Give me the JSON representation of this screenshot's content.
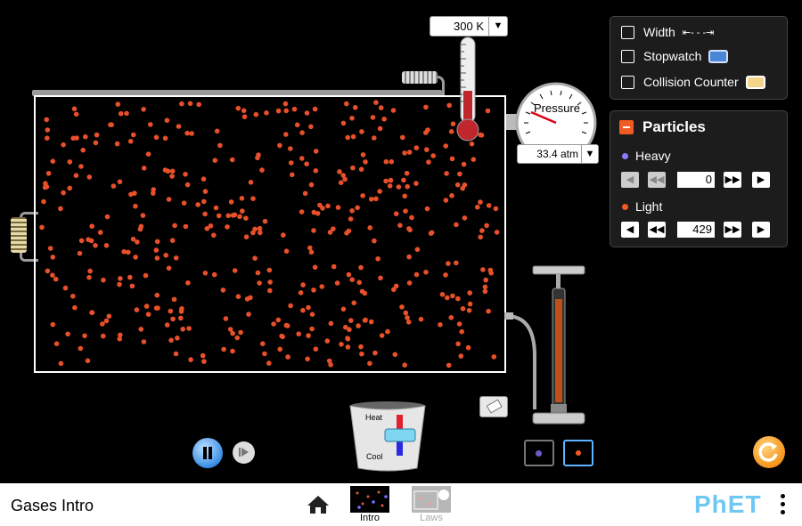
{
  "app": {
    "title": "Gases Intro"
  },
  "thermometer": {
    "value": "300 K",
    "dropdown_icon": "triangle-down-icon"
  },
  "pressure_gauge": {
    "label": "Pressure",
    "value": "33.4 atm",
    "dropdown_icon": "triangle-down-icon"
  },
  "tools_panel": {
    "width": {
      "label": "Width",
      "checked": false,
      "icon": "width-arrows-icon"
    },
    "stopwatch": {
      "label": "Stopwatch",
      "checked": false,
      "icon": "stopwatch-icon"
    },
    "collision_counter": {
      "label": "Collision Counter",
      "checked": false,
      "icon": "collision-counter-icon"
    }
  },
  "particles_panel": {
    "title": "Particles",
    "expanded": true,
    "heavy": {
      "label": "Heavy",
      "count": "0",
      "color": "#8a7cff"
    },
    "light": {
      "label": "Light",
      "count": "429",
      "color": "#f15a22"
    }
  },
  "heat_cool": {
    "heat_label": "Heat",
    "cool_label": "Cool"
  },
  "colors": {
    "particle_light": "#e8502a",
    "accent_blue": "#3a8ee6",
    "reset_orange": "#f5951c",
    "phet_blue": "#6fc8f3"
  },
  "navigation": {
    "screens": [
      {
        "label": "Intro",
        "selected": true
      },
      {
        "label": "Laws",
        "selected": false
      }
    ],
    "logo": "PhET"
  }
}
